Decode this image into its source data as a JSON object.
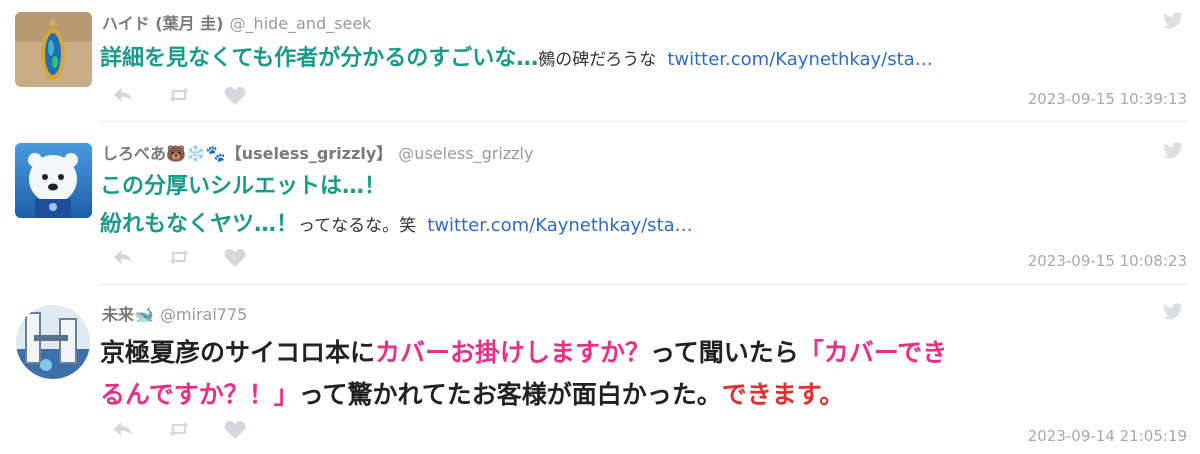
{
  "tweets": [
    {
      "name": "ハイド (葉月 圭)",
      "handle": "@_hide_and_seek",
      "line1_teal": "詳細を見なくても作者が分かるのすごいな…",
      "line1_plain": "鵺の碑だろうな",
      "link": "twitter.com/Kaynethkay/sta…",
      "timestamp": "2023-09-15 10:39:13"
    },
    {
      "name": "しろべあ🐻❄️🐾【useless_grizzly】",
      "handle": "@useless_grizzly",
      "line1_teal": "この分厚いシルエットは…！",
      "line2_teal": "紛れもなくヤツ…！",
      "line2_plain": "ってなるな。笑",
      "link": "twitter.com/Kaynethkay/sta…",
      "timestamp": "2023-09-15 10:08:23"
    },
    {
      "name": "未来🐋",
      "handle": "@mirai775",
      "seg1": "京極夏彦のサイコロ本に",
      "seg2": "カバーお掛けしますか？",
      "seg3": "って聞いたら",
      "seg4": "「カバーでき",
      "seg5": "るんですか？！」",
      "seg6": "って驚かれてたお客様が面白かった。",
      "seg7": "できます。",
      "timestamp": "2023-09-14 21:05:19"
    }
  ],
  "icons": [
    "reply-icon",
    "retweet-icon",
    "like-icon",
    "twitter-bird-icon"
  ],
  "colors": {
    "teal": "#1a9a8a",
    "link": "#2b6cc4",
    "pink": "#ea2f86",
    "red": "#e52e2e",
    "meta": "#a8a8a8"
  }
}
